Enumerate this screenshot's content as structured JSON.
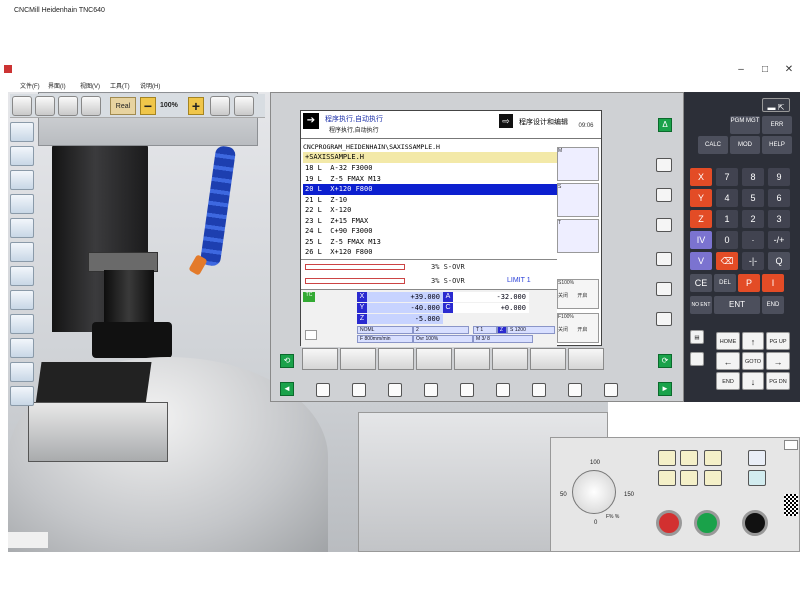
{
  "window": {
    "title": "CNCMill Heidenhain TNC640",
    "controls": [
      "–",
      "□",
      "✕"
    ]
  },
  "menu": [
    "文件(F)",
    "界面(I)",
    "视图(V)",
    "工具(T)",
    "说明(H)"
  ],
  "toolbar": {
    "real_label": "Real",
    "zoom_minus": "−",
    "zoom_level": "100%",
    "zoom_plus": "+"
  },
  "lcd": {
    "mode_line1": "程序执行,自动执行",
    "mode_line2": "程序执行,自动执行",
    "program_mode": "程序设计和编辑",
    "clock": "09:06",
    "path": "CNCPROGRAM_HEIDENHAIN\\SAXISSAMPLE.H",
    "file_row": "+SAXISSAMPLE.H",
    "nc_lines": [
      "18 L  A-32 F3000",
      "19 L  Z-5 FMAX M13",
      "20 L  X+120 F800",
      "21 L  Z-10",
      "22 L  X-120",
      "23 L  Z+15 FMAX",
      "24 L  C+90 F3000",
      "25 L  Z-5 FMAX M13",
      "26 L  X+120 F800"
    ],
    "active_line": 2,
    "ovr1": "3%  S-OVR",
    "ovr2": "3%  S-OVR",
    "limit": "LIMIT 1",
    "axes": [
      {
        "axis": "X",
        "value": "+39.000",
        "axis2": "A",
        "value2": "-32.000"
      },
      {
        "axis": "Y",
        "value": "-40.000",
        "axis2": "C",
        "value2": "+0.000"
      },
      {
        "axis": "Z",
        "value": "-5.000"
      }
    ],
    "status": {
      "noml": "NOML",
      "tool": "2",
      "t": "T 1",
      "z": "Z",
      "s": "S  1200",
      "f": "F 800mm/min",
      "ovr": "Ovr  100%",
      "m": "M 3/ 8"
    },
    "softkeys_side": [
      {
        "label": "M"
      },
      {
        "label": "S"
      },
      {
        "label": "T"
      },
      {
        "label": "S100%",
        "sub1": "关闭",
        "sub2": "开启"
      },
      {
        "label": "F100%",
        "sub1": "关闭",
        "sub2": "开启"
      }
    ],
    "green_label": "Δ"
  },
  "keypad": {
    "top": [
      "PGM MGT",
      "ERR",
      "CALC",
      "MOD",
      "HELP"
    ],
    "rows": [
      [
        "X",
        "7",
        "8",
        "9"
      ],
      [
        "Y",
        "4",
        "5",
        "6"
      ],
      [
        "Z",
        "1",
        "2",
        "3"
      ],
      [
        "IV",
        "0",
        "·",
        "-/+"
      ],
      [
        "V",
        "⌫",
        "-|-",
        "Q"
      ]
    ],
    "bottom": [
      "CE",
      "DEL",
      "P",
      "I",
      "NO ENT",
      "ENT",
      "END"
    ],
    "nav": [
      "HOME",
      "↑",
      "PG UP",
      "←",
      "GOTO",
      "→",
      "END",
      "↓",
      "PG DN"
    ]
  },
  "operator": {
    "dial_top": "100",
    "dial_left": "50",
    "dial_right": "150",
    "dial_bottom": "0",
    "dial_label": "F%  %"
  }
}
